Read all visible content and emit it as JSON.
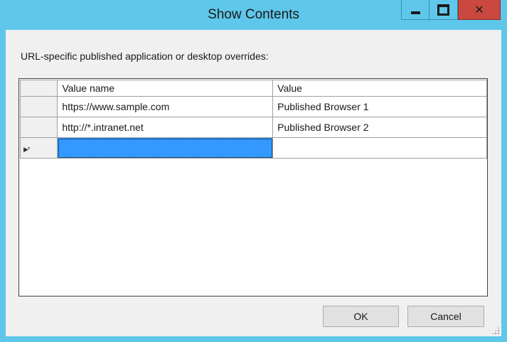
{
  "window": {
    "title": "Show Contents",
    "close_glyph": "✕"
  },
  "dialog": {
    "description": "URL-specific published application or desktop overrides:"
  },
  "grid": {
    "columns": [
      "Value name",
      "Value"
    ],
    "rows": [
      {
        "name": "https://www.sample.com",
        "value": "Published Browser 1"
      },
      {
        "name": "http://*.intranet.net",
        "value": "Published Browser 2"
      }
    ],
    "new_row_indicator": "▶*"
  },
  "buttons": {
    "ok": "OK",
    "cancel": "Cancel"
  },
  "colors": {
    "titlebar": "#5fc7ea",
    "close_button": "#c9483f",
    "selection": "#3399ff"
  },
  "icons": {
    "minimize": "minimize-icon",
    "maximize": "maximize-icon",
    "close": "close-icon",
    "resize_grip": "resize-grip-icon"
  }
}
